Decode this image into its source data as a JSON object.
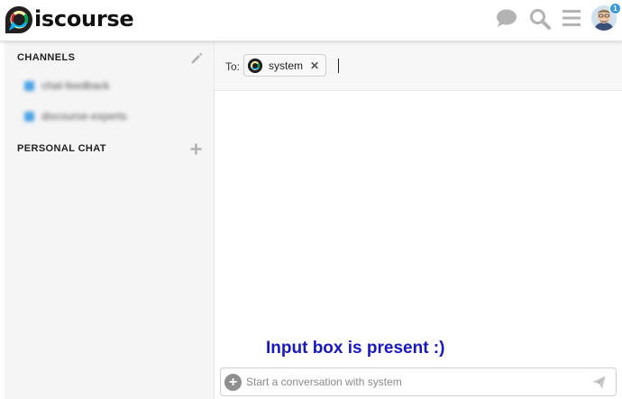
{
  "header": {
    "logo_text": "iscourse",
    "icons": [
      "chat-icon",
      "search-icon",
      "hamburger-menu-icon"
    ],
    "notification_count": "1"
  },
  "sidebar": {
    "channels_title": "CHANNELS",
    "channels": [
      {
        "label": "chat-feedback"
      },
      {
        "label": "discourse-experts"
      }
    ],
    "personal_chat_title": "PERSONAL CHAT"
  },
  "composer_to": {
    "label": "To:",
    "recipient": "system"
  },
  "annotation": "Input box is present :)",
  "composer": {
    "placeholder": "Start a conversation with system",
    "value": ""
  },
  "colors": {
    "annotation": "#1717c4",
    "badge": "#3a9ad9",
    "icon_gray": "#b3b3b3"
  }
}
